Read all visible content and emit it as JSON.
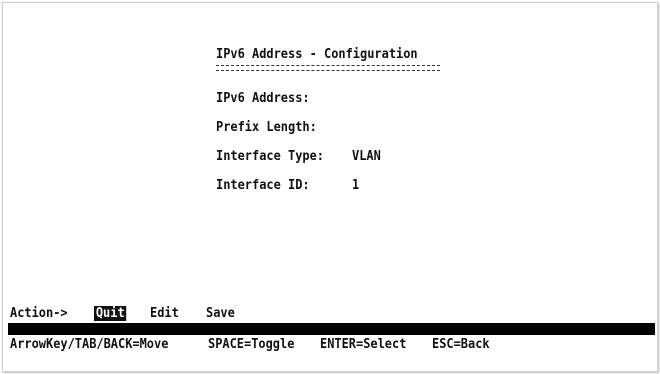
{
  "screen": {
    "title": "IPv6 Address - Configuration",
    "fields": [
      {
        "label": "IPv6 Address:",
        "value": ""
      },
      {
        "label": "Prefix Length:",
        "value": ""
      },
      {
        "label": "Interface Type:",
        "value": "VLAN"
      },
      {
        "label": "Interface ID:",
        "value": "1"
      }
    ]
  },
  "actions": {
    "label": "Action->",
    "quit": "Quit",
    "edit": "Edit",
    "save": "Save"
  },
  "help": {
    "move": "ArrowKey/TAB/BACK=Move",
    "toggle": "SPACE=Toggle",
    "select": "ENTER=Select",
    "back": "ESC=Back"
  },
  "colors": {
    "background": "#ffffff",
    "text": "#111111",
    "bar": "#000000",
    "highlight_bg": "#111111",
    "highlight_text": "#ffffff"
  }
}
